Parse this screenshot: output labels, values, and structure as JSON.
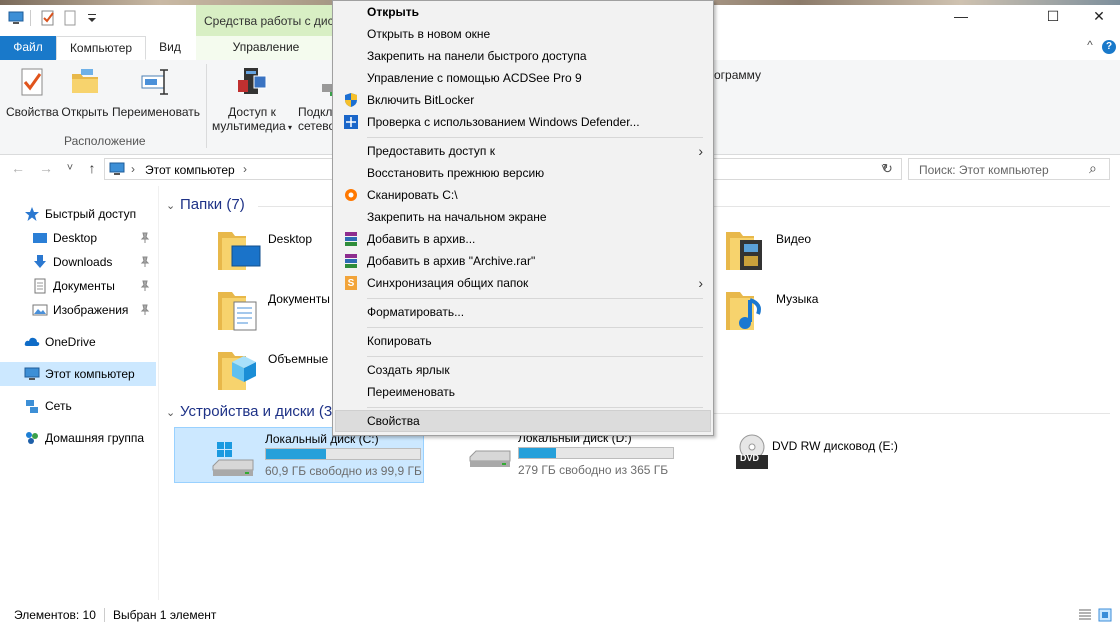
{
  "titlebar": {
    "context_tab_title": "Средства работы с диск",
    "minimize": "—",
    "maximize": "☐",
    "close": "✕"
  },
  "ribbon_tabs": {
    "file": "Файл",
    "computer": "Компьютер",
    "view": "Вид",
    "manage": "Управление",
    "collapse": "^",
    "help": "?"
  },
  "ribbon": {
    "properties": "Свойства",
    "open": "Открыть",
    "rename": "Переименовать",
    "group_location": "Расположение",
    "media_access_1": "Доступ к",
    "media_access_2": "мультимедиа",
    "map_drive_1": "Подкл",
    "map_drive_2": "сетево",
    "programs_fragment": "ограмму"
  },
  "address": {
    "back": "←",
    "forward": "→",
    "recent": "˅",
    "up": "↑",
    "path": "Этот компьютер",
    "sep": "›",
    "dropdown": "˅",
    "refresh": "↻",
    "search_placeholder": "Поиск: Этот компьютер",
    "search_icon": "⌕"
  },
  "nav": {
    "quick_access": "Быстрый доступ",
    "desktop": "Desktop",
    "downloads": "Downloads",
    "documents": "Документы",
    "images": "Изображения",
    "onedrive": "OneDrive",
    "this_pc": "Этот компьютер",
    "network": "Сеть",
    "homegroup": "Домашняя группа"
  },
  "content": {
    "folders_header": "Папки (7)",
    "devices_header": "Устройства и диски (3",
    "chevron": "⌄",
    "folders": {
      "desktop": "Desktop",
      "documents": "Документы",
      "objects": "Объемные о",
      "video": "Видео",
      "music": "Музыка"
    },
    "drives": {
      "c_name": "Локальный диск (C:)",
      "c_free": "60,9 ГБ свободно из 99,9 ГБ",
      "c_used_fraction": 0.39,
      "d_name": "Локальный диск (D:)",
      "d_free": "279 ГБ свободно из 365 ГБ",
      "d_used_fraction": 0.24,
      "e_name": "DVD RW дисковод (E:)",
      "dvd_label": "DVD"
    }
  },
  "status": {
    "items": "Элементов: 10",
    "selected": "Выбран 1 элемент"
  },
  "context_menu": {
    "open": "Открыть",
    "open_new_window": "Открыть в новом окне",
    "pin_quick_access": "Закрепить на панели быстрого доступа",
    "acdsee": "Управление с помощью ACDSee Pro 9",
    "bitlocker": "Включить BitLocker",
    "defender": "Проверка с использованием Windows Defender...",
    "share": "Предоставить доступ к",
    "restore": "Восстановить прежнюю версию",
    "scan": "Сканировать C:\\",
    "pin_start": "Закрепить на начальном экране",
    "add_archive": "Добавить в архив...",
    "add_archive_rar": "Добавить в архив \"Archive.rar\"",
    "sync": "Синхронизация общих папок",
    "format": "Форматировать...",
    "copy": "Копировать",
    "shortcut": "Создать ярлык",
    "rename": "Переименовать",
    "properties": "Свойства",
    "arrow": "›",
    "sync_icon_letter": "S"
  }
}
